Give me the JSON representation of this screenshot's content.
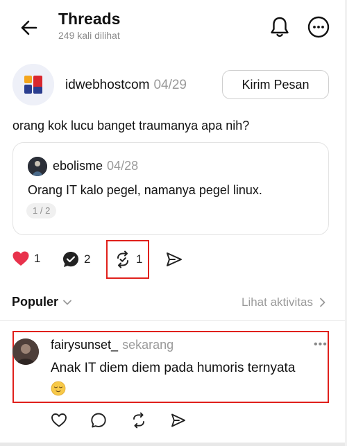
{
  "header": {
    "title": "Threads",
    "views": "249 kali dilihat"
  },
  "post": {
    "author": "idwebhostcom",
    "date": "04/29",
    "message_button": "Kirim Pesan",
    "text": "orang kok lucu banget traumanya apa nih?",
    "quote": {
      "author": "ebolisme",
      "date": "04/28",
      "text": "Orang IT kalo pegel, namanya pegel linux.",
      "page": "1 / 2"
    },
    "stats": {
      "likes": "1",
      "replies": "2",
      "reposts": "1"
    }
  },
  "sort": {
    "label": "Populer",
    "activity_link": "Lihat aktivitas"
  },
  "comment": {
    "author": "fairysunset_",
    "time": "sekarang",
    "more": "•••",
    "text": "Anak IT diem diem pada humoris ternyata"
  },
  "colors": {
    "like_red": "#e8324c",
    "highlight_red": "#e0201b",
    "muted": "#9a9a9a",
    "brand_red": "#d9272e",
    "brand_blue": "#2a3d8f",
    "brand_yellow": "#f4a51c"
  },
  "icons": {
    "back": "arrow-left-icon",
    "bell": "bell-icon",
    "more": "more-circle-icon",
    "like": "heart-filled-icon",
    "reply": "speech-bubble-icon",
    "repost": "repost-icon",
    "share": "send-icon",
    "chevron_down": "chevron-down-icon",
    "chevron_right": "chevron-right-icon",
    "emoji": "relieved-face-icon"
  }
}
